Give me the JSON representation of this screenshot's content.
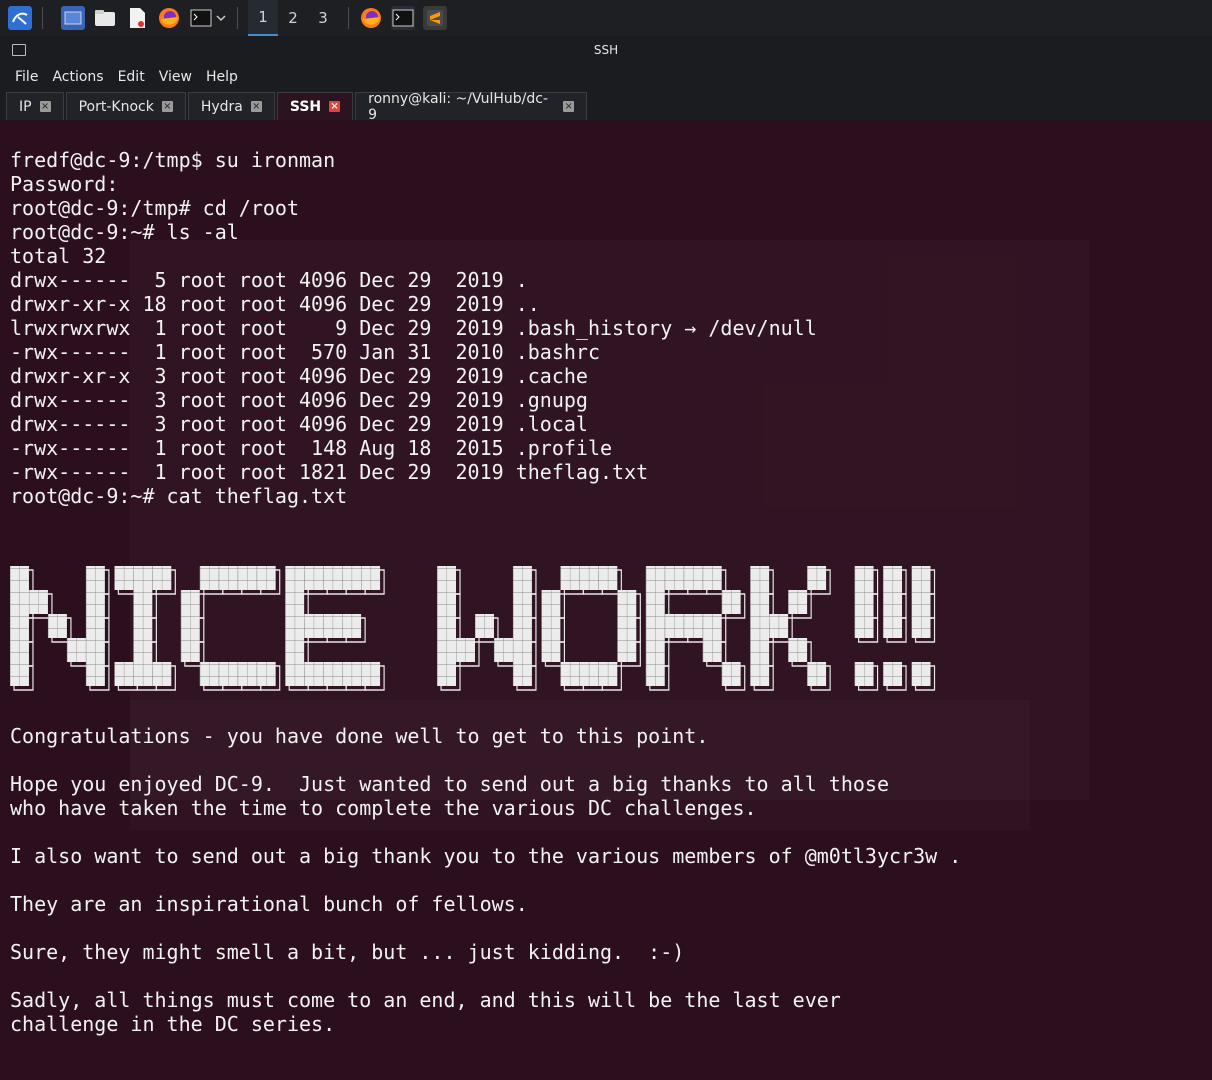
{
  "taskbar": {
    "icons": [
      "kali-menu-icon",
      "desktop-icon",
      "file-manager-icon",
      "text-editor-icon",
      "firefox-icon",
      "terminal-icon"
    ],
    "workspaces": [
      "1",
      "2",
      "3"
    ],
    "active_workspace": "1",
    "pinned_apps": [
      "firefox-icon",
      "terminal-icon",
      "sublime-icon"
    ]
  },
  "window": {
    "title": "SSH"
  },
  "menubar": {
    "items": [
      "File",
      "Actions",
      "Edit",
      "View",
      "Help"
    ]
  },
  "tabs": [
    {
      "label": "IP",
      "active": false
    },
    {
      "label": "Port-Knock",
      "active": false
    },
    {
      "label": "Hydra",
      "active": false
    },
    {
      "label": "SSH",
      "active": true
    },
    {
      "label": "ronny@kali: ~/VulHub/dc-9",
      "active": false
    }
  ],
  "terminal": {
    "lines_top": [
      "fredf@dc-9:/tmp$ su ironman",
      "Password:",
      "root@dc-9:/tmp# cd /root",
      "root@dc-9:~# ls -al",
      "total 32",
      "drwx------  5 root root 4096 Dec 29  2019 .",
      "drwxr-xr-x 18 root root 4096 Dec 29  2019 ..",
      "lrwxrwxrwx  1 root root    9 Dec 29  2019 .bash_history → /dev/null",
      "-rwx------  1 root root  570 Jan 31  2010 .bashrc",
      "drwxr-xr-x  3 root root 4096 Dec 29  2019 .cache",
      "drwx------  3 root root 4096 Dec 29  2019 .gnupg",
      "drwx------  3 root root 4096 Dec 29  2019 .local",
      "-rwx------  1 root root  148 Aug 18  2015 .profile",
      "-rwx------  1 root root 1821 Dec 29  2019 theflag.txt",
      "root@dc-9:~# cat theflag.txt"
    ],
    "banner": "NICE WORK!!!",
    "lines_bottom": [
      "Congratulations - you have done well to get to this point.",
      "",
      "Hope you enjoyed DC-9.  Just wanted to send out a big thanks to all those",
      "who have taken the time to complete the various DC challenges.",
      "",
      "I also want to send out a big thank you to the various members of @m0tl3ycr3w .",
      "",
      "They are an inspirational bunch of fellows.",
      "",
      "Sure, they might smell a bit, but ... just kidding.  :-)",
      "",
      "Sadly, all things must come to an end, and this will be the last ever",
      "challenge in the DC series."
    ]
  },
  "colors": {
    "terminal_bg": "#2c0f1e",
    "terminal_fg": "#f2f2f2",
    "chrome_bg": "#1b1c20",
    "active_tab_close": "#e0443e",
    "workspace_accent": "#3a8fd8"
  }
}
